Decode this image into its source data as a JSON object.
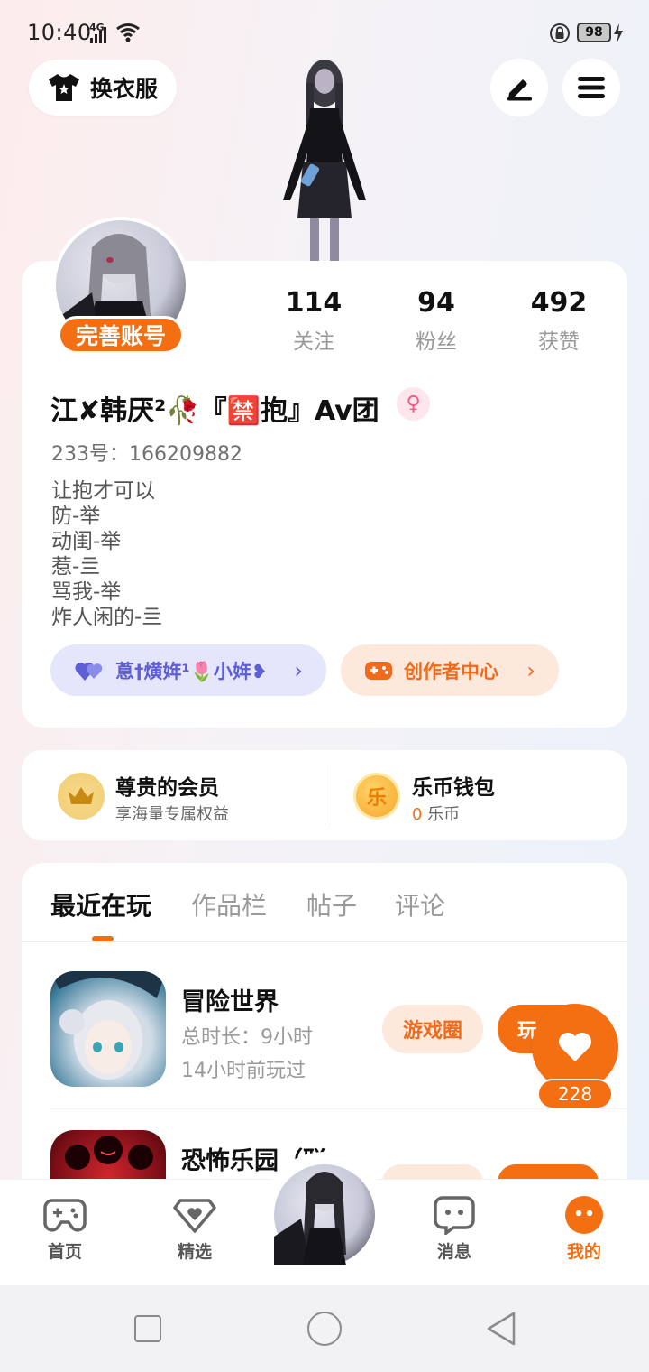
{
  "status_bar": {
    "time": "10:40",
    "network": "4G",
    "battery": "98"
  },
  "top_actions": {
    "outfit_label": "换衣服",
    "edit_icon": "edit-pen-icon",
    "menu_icon": "menu-icon"
  },
  "profile": {
    "complete_account_label": "完善账号",
    "stats": [
      {
        "value": "114",
        "label": "关注"
      },
      {
        "value": "94",
        "label": "粉丝"
      },
      {
        "value": "492",
        "label": "获赞"
      }
    ],
    "nickname": "江✘韩厌²🥀『🈲抱』Av团",
    "gender_symbol": "♀",
    "uid": "233号：166209882",
    "bio_lines": [
      "让抱才可以",
      "防-举",
      "动闺-举",
      "惹-亖",
      "骂我-举",
      "炸人闲的-亖"
    ],
    "fan_group_label": "蒠†熿姩¹🌷小姩❥",
    "creator_center_label": "创作者中心",
    "chevron": "›"
  },
  "vip": {
    "title": "尊贵的会员",
    "subtitle": "享海量专属权益"
  },
  "wallet": {
    "title": "乐币钱包",
    "coin_glyph": "乐",
    "amount": "0",
    "unit": "乐币"
  },
  "tabs": [
    {
      "label": "最近在玩",
      "active": true
    },
    {
      "label": "作品栏",
      "active": false
    },
    {
      "label": "帖子",
      "active": false
    },
    {
      "label": "评论",
      "active": false
    }
  ],
  "games": [
    {
      "name": "冒险世界",
      "total_time": "总时长：9小时",
      "last_played": "14小时前玩过",
      "circle_label": "游戏圈",
      "play_label": "玩"
    },
    {
      "name": "恐怖乐园（联"
    }
  ],
  "like_fab": {
    "count": "228"
  },
  "bottom_nav": [
    {
      "label": "首页",
      "icon": "gamepad-icon"
    },
    {
      "label": "精选",
      "icon": "heart-badge-icon"
    },
    {
      "label": "消息",
      "icon": "chat-icon"
    },
    {
      "label": "我的",
      "icon": "profile-dots-icon",
      "active": true
    }
  ],
  "colors": {
    "accent": "#f46f12",
    "fan_pill_bg": "#e5e6fb",
    "fan_pill_text": "#5e5fd6",
    "creator_pill_bg": "#fde8dc"
  }
}
